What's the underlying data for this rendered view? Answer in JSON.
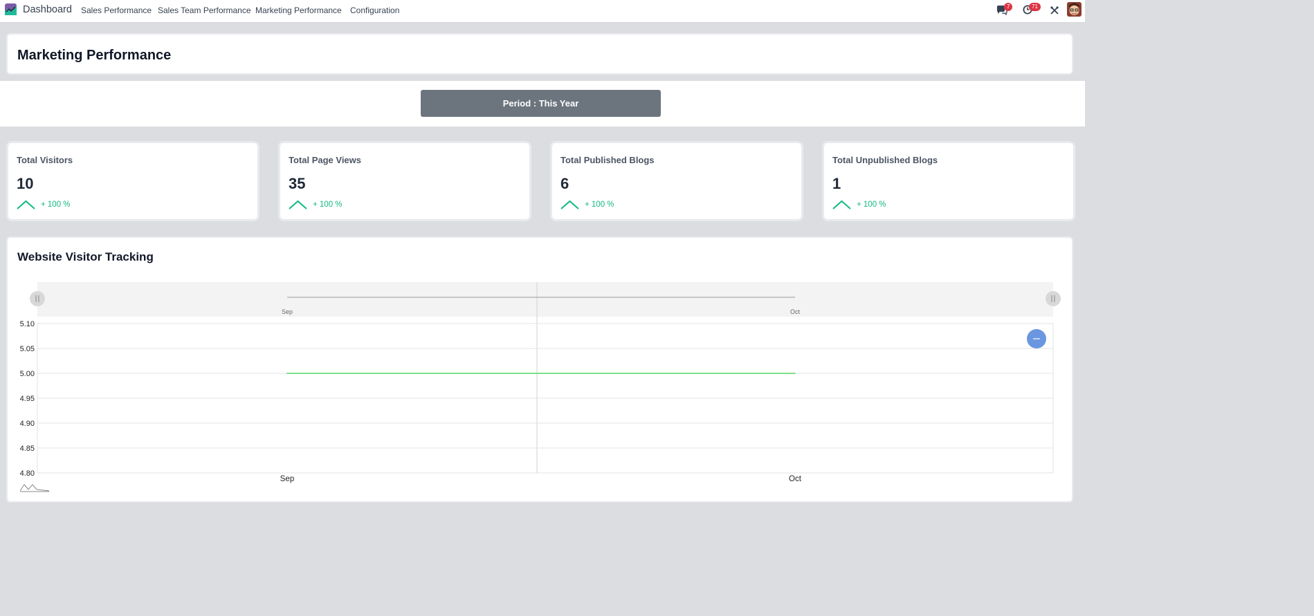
{
  "navbar": {
    "app_name": "Dashboard",
    "menu": [
      {
        "label": "Sales Performance"
      },
      {
        "label": "Sales Team Performance"
      },
      {
        "label": "Marketing Performance"
      },
      {
        "label": "Configuration"
      }
    ],
    "messages_badge": "7",
    "activities_badge": "71",
    "icons": [
      "chat-icon",
      "clock-icon",
      "tools-icon",
      "avatar"
    ]
  },
  "header": {
    "title": "Marketing Performance"
  },
  "period": {
    "label": "Period : This Year"
  },
  "kpis": [
    {
      "title": "Total Visitors",
      "value": "10",
      "change": "+ 100 %"
    },
    {
      "title": "Total Page Views",
      "value": "35",
      "change": "+ 100 %"
    },
    {
      "title": "Total Published Blogs",
      "value": "6",
      "change": "+ 100 %"
    },
    {
      "title": "Total Unpublished Blogs",
      "value": "1",
      "change": "+ 100 %"
    }
  ],
  "colors": {
    "accent_green": "#10b981",
    "period_button": "#6c757d",
    "line_color": "#7ee08a",
    "zoom_button": "#6b96e0"
  },
  "chart_section": {
    "title": "Website Visitor Tracking"
  },
  "chart_data": {
    "type": "line",
    "categories": [
      "Sep",
      "Oct"
    ],
    "series": [
      {
        "values": [
          5.0,
          5.0
        ]
      }
    ],
    "yticks": [
      "5.10",
      "5.05",
      "5.00",
      "4.95",
      "4.90",
      "4.85",
      "4.80"
    ],
    "ylim": [
      4.8,
      5.1
    ],
    "xlabel": "",
    "ylabel": "",
    "grid": true,
    "navigator_labels": [
      "Sep",
      "Oct"
    ]
  }
}
